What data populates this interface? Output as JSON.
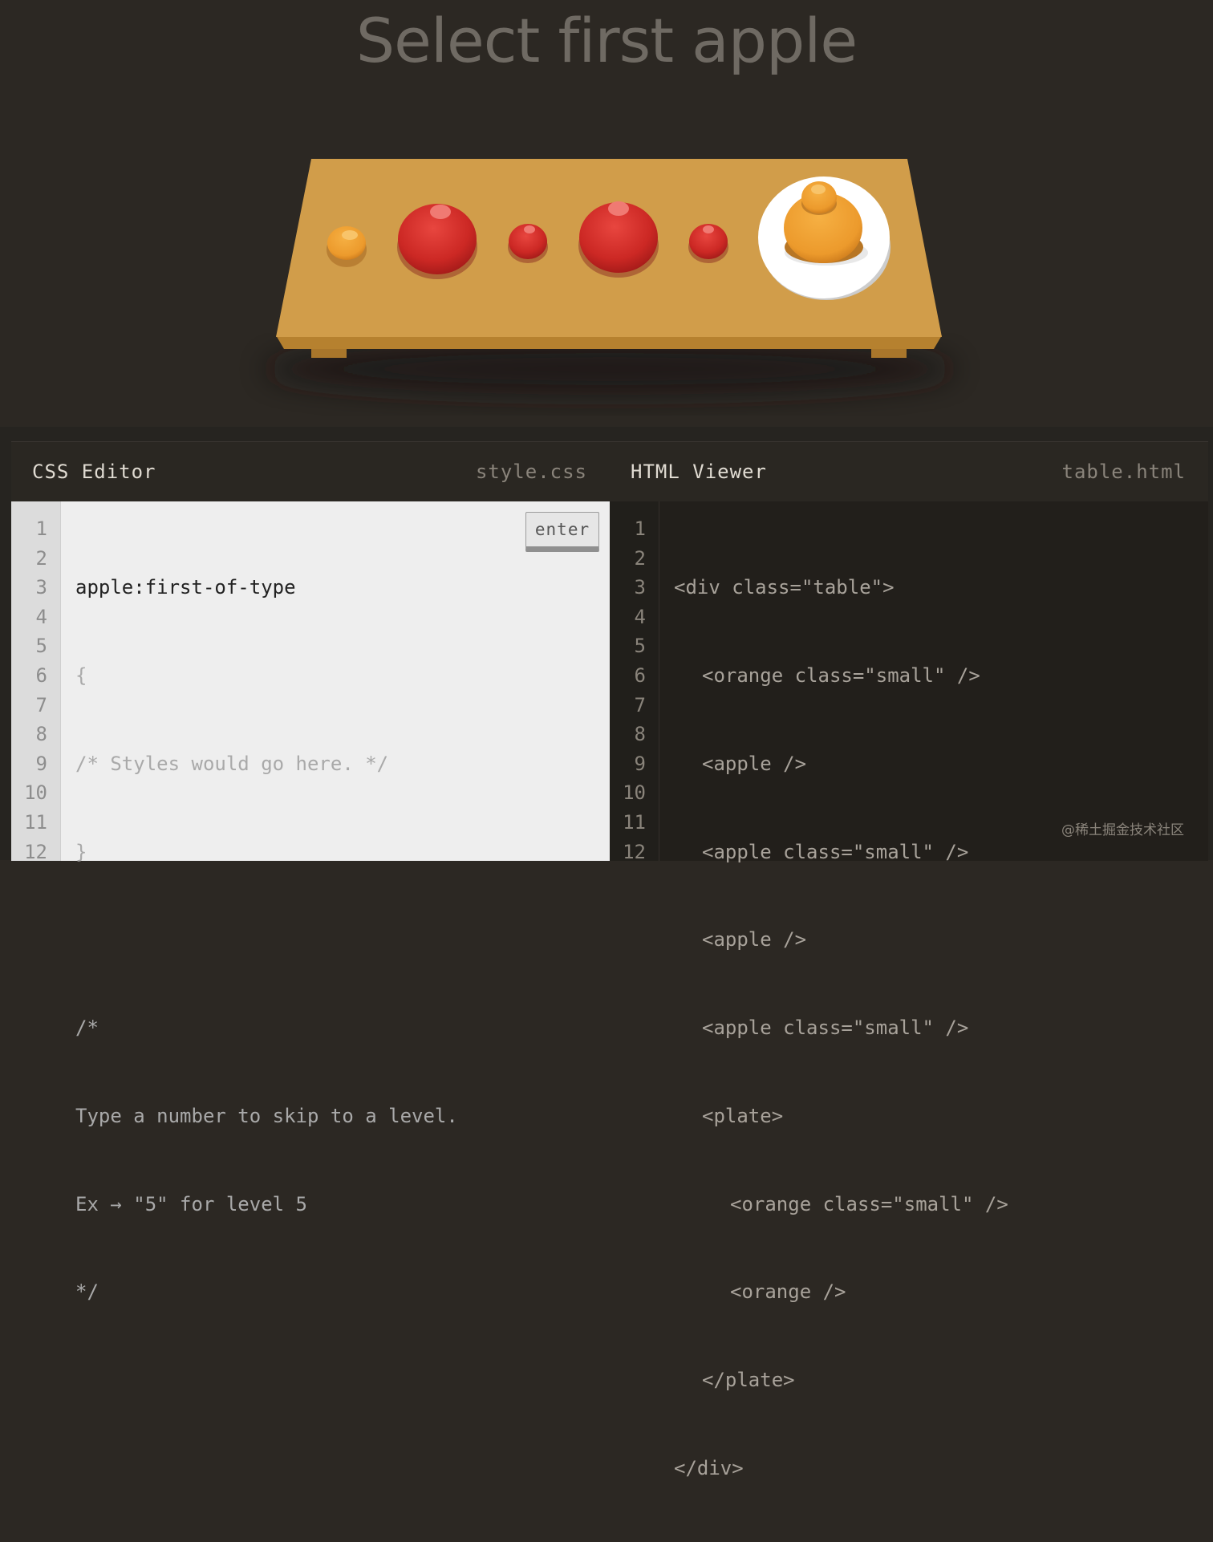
{
  "header": {
    "title": "Select first apple"
  },
  "board": {
    "items": [
      {
        "type": "orange",
        "size": "small"
      },
      {
        "type": "apple",
        "size": "large"
      },
      {
        "type": "apple",
        "size": "small"
      },
      {
        "type": "apple",
        "size": "large"
      },
      {
        "type": "apple",
        "size": "small"
      },
      {
        "type": "plate",
        "contents": [
          "orange small",
          "orange"
        ]
      }
    ],
    "colors": {
      "table_top": "#d09c48",
      "table_front": "#b47f2f",
      "apple": "#cf2a26",
      "orange": "#ef9d2e",
      "plate": "#ffffff"
    }
  },
  "css_editor": {
    "title": "CSS Editor",
    "filename": "style.css",
    "enter_label": "enter",
    "input_value": "apple:first-of-type",
    "line_numbers": [
      "1",
      "2",
      "3",
      "4",
      "5",
      "6",
      "7",
      "8",
      "9",
      "10",
      "11",
      "12"
    ],
    "lines": [
      "{",
      "/* Styles would go here. */",
      "}",
      "",
      "/*",
      "Type a number to skip to a level.",
      "Ex → \"5\" for level 5",
      "*/"
    ]
  },
  "html_viewer": {
    "title": "HTML Viewer",
    "filename": "table.html",
    "line_numbers": [
      "1",
      "2",
      "3",
      "4",
      "5",
      "6",
      "7",
      "8",
      "9",
      "10",
      "11",
      "12"
    ],
    "lines": [
      "<div class=\"table\">",
      "<orange class=\"small\" />",
      "<apple />",
      "<apple class=\"small\" />",
      "<apple />",
      "<apple class=\"small\" />",
      "<plate>",
      "<orange class=\"small\" />",
      "<orange />",
      "</plate>",
      "</div>"
    ]
  },
  "watermark": "@稀土掘金技术社区"
}
